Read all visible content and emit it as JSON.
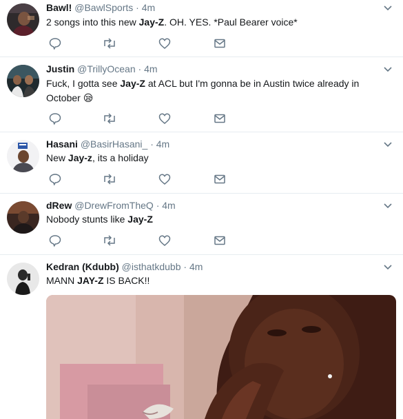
{
  "tweets": [
    {
      "name": "Bawl!",
      "handle": "@BawlSports",
      "sep": "·",
      "time": "4m",
      "text_parts": [
        "2 songs into this new ",
        "Jay-Z",
        ". OH. YES. *Paul Bearer voice*"
      ]
    },
    {
      "name": "Justin",
      "handle": "@TrillyOcean",
      "sep": "·",
      "time": "4m",
      "text_parts": [
        "Fuck, I gotta see ",
        "Jay-Z",
        " at ACL but I'm gonna be in Austin twice already in October "
      ],
      "emoji": "😪"
    },
    {
      "name": "Hasani",
      "handle": "@BasirHasani_",
      "sep": "·",
      "time": "4m",
      "text_parts": [
        "New ",
        "Jay-z",
        ", its a holiday"
      ]
    },
    {
      "name": "dRew",
      "handle": "@DrewFromTheQ",
      "sep": "·",
      "time": "4m",
      "text_parts": [
        "Nobody stunts like ",
        "Jay-Z",
        ""
      ]
    },
    {
      "name": "Kedran (Kdubb)",
      "handle": "@isthatkdubb",
      "sep": "·",
      "time": "4m",
      "text_parts": [
        "MANN ",
        "JAY-Z",
        " IS BACK!!"
      ]
    }
  ],
  "icons": {
    "reply": "reply-icon",
    "retweet": "retweet-icon",
    "like": "like-icon",
    "dm": "direct-message-icon",
    "caret": "chevron-down-icon"
  },
  "colors": {
    "name": "#14171a",
    "secondary": "#657786",
    "divider": "#e6ecf0"
  }
}
